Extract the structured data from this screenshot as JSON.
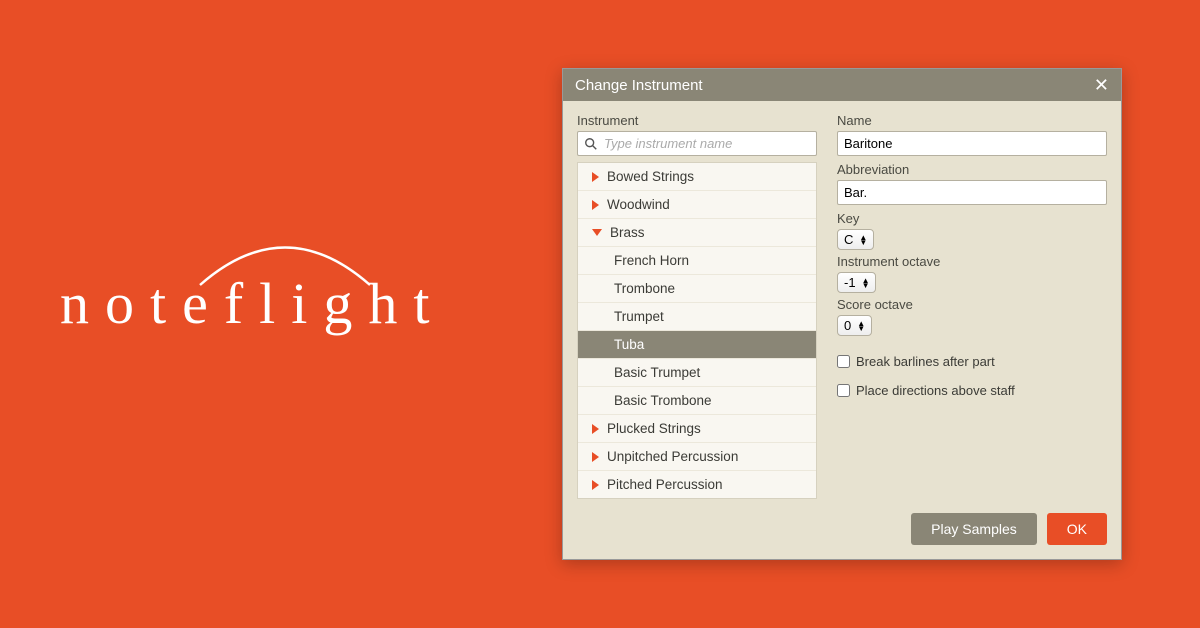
{
  "logo": {
    "text": "noteflight"
  },
  "dialog": {
    "title": "Change Instrument",
    "instrument_label": "Instrument",
    "search_placeholder": "Type instrument name",
    "tree": {
      "bowed_strings": "Bowed Strings",
      "woodwind": "Woodwind",
      "brass": "Brass",
      "brass_children": {
        "french_horn": "French Horn",
        "trombone": "Trombone",
        "trumpet": "Trumpet",
        "tuba": "Tuba",
        "basic_trumpet": "Basic Trumpet",
        "basic_trombone": "Basic Trombone"
      },
      "plucked_strings": "Plucked Strings",
      "unpitched_percussion": "Unpitched Percussion",
      "pitched_percussion": "Pitched Percussion"
    },
    "name_label": "Name",
    "name_value": "Baritone",
    "abbrev_label": "Abbreviation",
    "abbrev_value": "Bar.",
    "key_label": "Key",
    "key_value": "C",
    "inst_octave_label": "Instrument octave",
    "inst_octave_value": "-1",
    "score_octave_label": "Score octave",
    "score_octave_value": "0",
    "break_barlines_label": "Break barlines after part",
    "place_directions_label": "Place directions above staff",
    "play_samples_label": "Play Samples",
    "ok_label": "OK"
  }
}
